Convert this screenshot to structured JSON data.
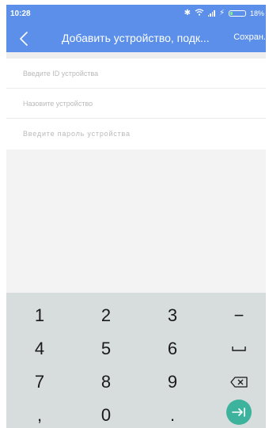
{
  "status_bar": {
    "time": "10:28",
    "battery_percent": "18%",
    "battery_level": 0.18,
    "icons": [
      "bluetooth-icon",
      "wifi-icon",
      "signal-icon",
      "charging-icon",
      "battery-icon"
    ]
  },
  "app_bar": {
    "title": "Добавить устройство, подк...",
    "save_label": "Сохран.",
    "back_icon": "chevron-left-icon",
    "color": "#5b8fe9"
  },
  "form": {
    "device_id": {
      "placeholder": "Введите ID устройства",
      "value": ""
    },
    "device_name": {
      "placeholder": "Назовите устройство",
      "value": ""
    },
    "device_password": {
      "placeholder": "Введите пароль устройства",
      "value": ""
    }
  },
  "keyboard": {
    "rows": [
      [
        "1",
        "2",
        "3",
        "−"
      ],
      [
        "4",
        "5",
        "6",
        "space"
      ],
      [
        "7",
        "8",
        "9",
        "backspace"
      ],
      [
        ",",
        "0",
        ".",
        "enter"
      ]
    ],
    "labels": {
      "k1": "1",
      "k2": "2",
      "k3": "3",
      "minus": "−",
      "k4": "4",
      "k5": "5",
      "k6": "6",
      "k7": "7",
      "k8": "8",
      "k9": "9",
      "comma": ",",
      "k0": "0",
      "dot": "."
    },
    "background": "#d7dcdc",
    "enter_color": "#3db39e"
  }
}
